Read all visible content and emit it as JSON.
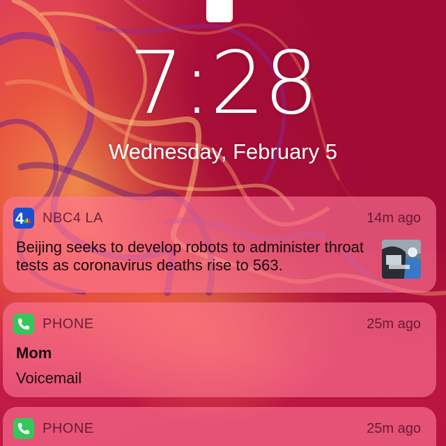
{
  "lockscreen": {
    "time": "7:28",
    "date": "Wednesday, February 5"
  },
  "notifications": [
    {
      "app": "NBC4 LA",
      "icon": "nbc4-icon",
      "time_ago": "14m ago",
      "message": "Beijing seeks to develop robots to administer throat tests as coronavirus deaths rise to 563."
    },
    {
      "app": "PHONE",
      "icon": "phone-icon",
      "time_ago": "25m ago",
      "title": "Mom",
      "subtitle": "Voicemail"
    },
    {
      "app": "PHONE",
      "icon": "phone-icon",
      "time_ago": "25m ago"
    }
  ],
  "colors": {
    "phone_green": "#34c759",
    "nbc_blue": "#1a4fd0"
  }
}
